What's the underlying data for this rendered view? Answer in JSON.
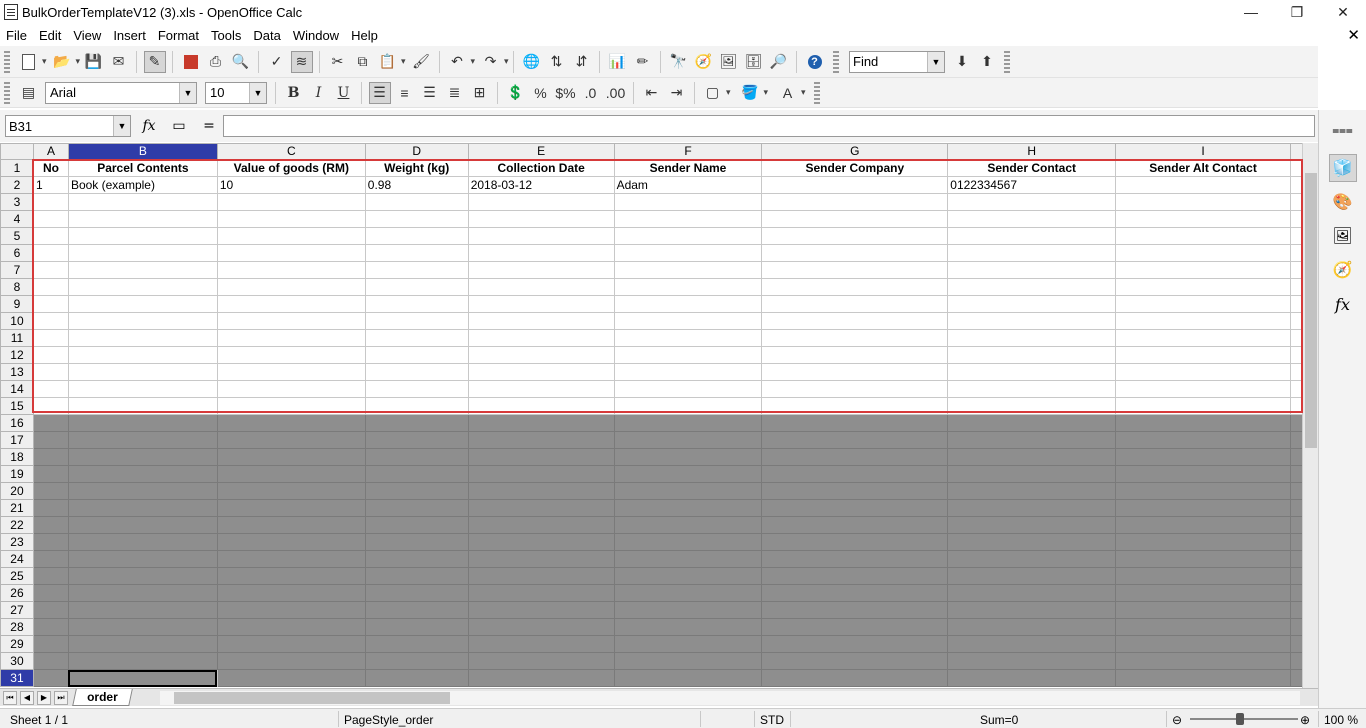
{
  "window": {
    "title": "BulkOrderTemplateV12 (3).xls - OpenOffice Calc",
    "minimize": "—",
    "restore": "❐",
    "close": "✕",
    "doc_close": "✕"
  },
  "menu": [
    "File",
    "Edit",
    "View",
    "Insert",
    "Format",
    "Tools",
    "Data",
    "Window",
    "Help"
  ],
  "toolbar": {
    "find_placeholder": "Find",
    "font_name": "Arial",
    "font_size": "10",
    "bold": "B",
    "italic": "I",
    "underline": "U",
    "percent": "%"
  },
  "formula_bar": {
    "cell_ref": "B31",
    "function_wizard": "fx",
    "equals": "="
  },
  "columns": [
    "A",
    "B",
    "C",
    "D",
    "E",
    "F",
    "G",
    "H",
    "I"
  ],
  "header_row": [
    "No",
    "Parcel Contents",
    "Value of goods (RM)",
    "Weight (kg)",
    "Collection Date",
    "Sender Name",
    "Sender Company",
    "Sender Contact",
    "Sender Alt Contact"
  ],
  "data_row": [
    "1",
    "Book (example)",
    "10",
    "0.98",
    "2018-03-12",
    "Adam",
    "",
    "0122334567",
    ""
  ],
  "overflow_hint": "a",
  "rows": [
    "1",
    "2",
    "3",
    "4",
    "5",
    "6",
    "7",
    "8",
    "9",
    "10",
    "11",
    "12",
    "13",
    "14",
    "15",
    "16",
    "17",
    "18",
    "19",
    "20",
    "21",
    "22",
    "23",
    "24",
    "25",
    "26",
    "27",
    "28",
    "29",
    "30",
    "31"
  ],
  "sheet_tab": "order",
  "status": {
    "sheet": "Sheet 1 / 1",
    "page_style": "PageStyle_order",
    "mode": "STD",
    "sum": "Sum=0",
    "zoom": "100 %"
  }
}
